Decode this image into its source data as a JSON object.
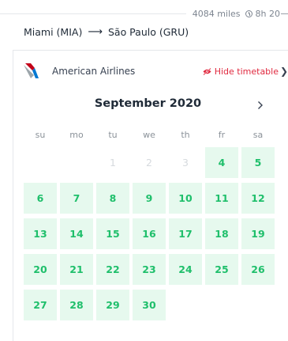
{
  "meta": {
    "distance": "4084 miles",
    "duration": "8h 20"
  },
  "route": {
    "from": "Miami (MIA)",
    "arrow": "⟶",
    "to": "São Paulo (GRU)"
  },
  "airline": {
    "name": "American Airlines",
    "hide_label": "Hide timetable",
    "logo_colors": [
      "#0078d2",
      "#c30019",
      "#9da6ab"
    ]
  },
  "calendar": {
    "month_title": "September 2020",
    "next_icon": "chevron-right-icon",
    "weekdays": [
      "su",
      "mo",
      "tu",
      "we",
      "th",
      "fr",
      "sa"
    ],
    "weeks": [
      [
        null,
        null,
        {
          "d": "1",
          "state": "past"
        },
        {
          "d": "2",
          "state": "past"
        },
        {
          "d": "3",
          "state": "past"
        },
        {
          "d": "4",
          "state": "available"
        },
        {
          "d": "5",
          "state": "available"
        }
      ],
      [
        {
          "d": "6",
          "state": "available"
        },
        {
          "d": "7",
          "state": "available"
        },
        {
          "d": "8",
          "state": "available"
        },
        {
          "d": "9",
          "state": "available"
        },
        {
          "d": "10",
          "state": "available"
        },
        {
          "d": "11",
          "state": "available"
        },
        {
          "d": "12",
          "state": "available"
        }
      ],
      [
        {
          "d": "13",
          "state": "available"
        },
        {
          "d": "14",
          "state": "available"
        },
        {
          "d": "15",
          "state": "available"
        },
        {
          "d": "16",
          "state": "available"
        },
        {
          "d": "17",
          "state": "available"
        },
        {
          "d": "18",
          "state": "available"
        },
        {
          "d": "19",
          "state": "available"
        }
      ],
      [
        {
          "d": "20",
          "state": "available"
        },
        {
          "d": "21",
          "state": "available"
        },
        {
          "d": "22",
          "state": "available"
        },
        {
          "d": "23",
          "state": "available"
        },
        {
          "d": "24",
          "state": "available"
        },
        {
          "d": "25",
          "state": "available"
        },
        {
          "d": "26",
          "state": "available"
        }
      ],
      [
        {
          "d": "27",
          "state": "available"
        },
        {
          "d": "28",
          "state": "available"
        },
        {
          "d": "29",
          "state": "available"
        },
        {
          "d": "30",
          "state": "available"
        },
        null,
        null,
        null
      ]
    ]
  },
  "colors": {
    "available_bg": "#e6f9ee",
    "available_text": "#1fbf6b",
    "past_text": "#d6dade",
    "accent_red": "#e0293f"
  }
}
